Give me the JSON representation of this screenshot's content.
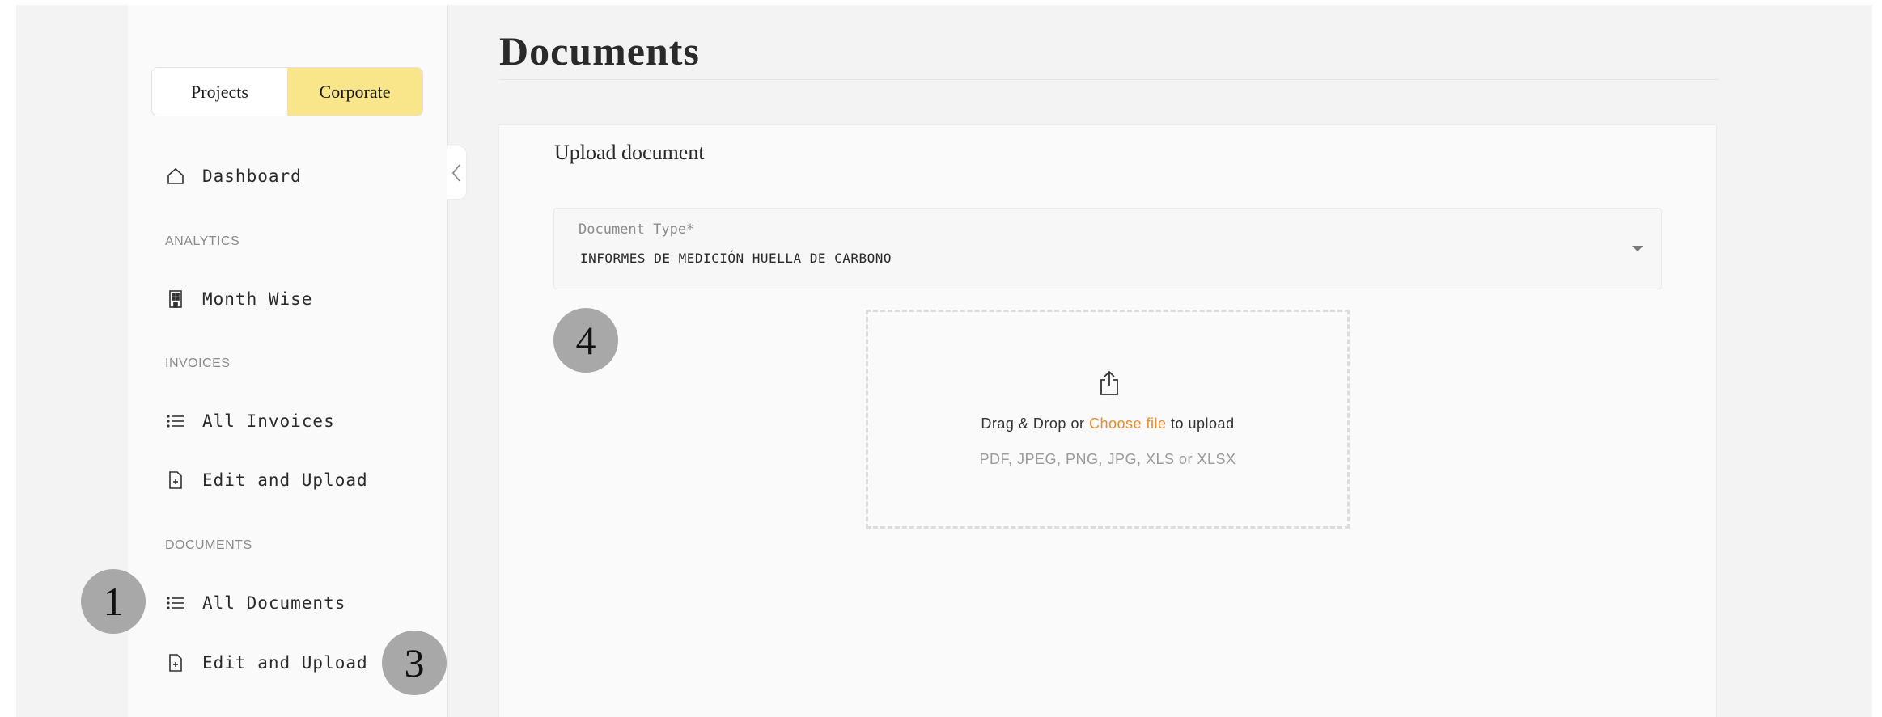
{
  "toggle": {
    "projects": "Projects",
    "corporate": "Corporate",
    "active": "corporate"
  },
  "sidebar": {
    "dashboard": {
      "label": "Dashboard",
      "icon": "home-icon"
    },
    "analytics_label": "ANALYTICS",
    "month_wise": {
      "label": "Month Wise",
      "icon": "building-icon"
    },
    "invoices_label": "INVOICES",
    "all_invoices": {
      "label": "All Invoices",
      "icon": "list-icon"
    },
    "invoices_edit_upload": {
      "label": "Edit and Upload",
      "icon": "file-plus-icon"
    },
    "documents_label": "DOCUMENTS",
    "all_documents": {
      "label": "All Documents",
      "icon": "list-icon"
    },
    "documents_edit_upload": {
      "label": "Edit and Upload",
      "icon": "file-plus-icon"
    }
  },
  "page": {
    "title": "Documents"
  },
  "upload_card": {
    "title": "Upload document",
    "document_type": {
      "label": "Document Type*",
      "value": "INFORMES DE MEDICIÓN HUELLA DE CARBONO"
    },
    "dropzone": {
      "text_before": "Drag & Drop or ",
      "link": "Choose file",
      "text_after": " to upload",
      "formats": "PDF, JPEG, PNG, JPG, XLS or XLSX"
    }
  },
  "annotations": {
    "one": "1",
    "three": "3",
    "four": "4"
  },
  "colors": {
    "accent": "#f9e58a",
    "link": "#e8892f",
    "badge": "#a8a8a8",
    "background": "#f3f3f3",
    "sidebar": "#fafafa"
  }
}
